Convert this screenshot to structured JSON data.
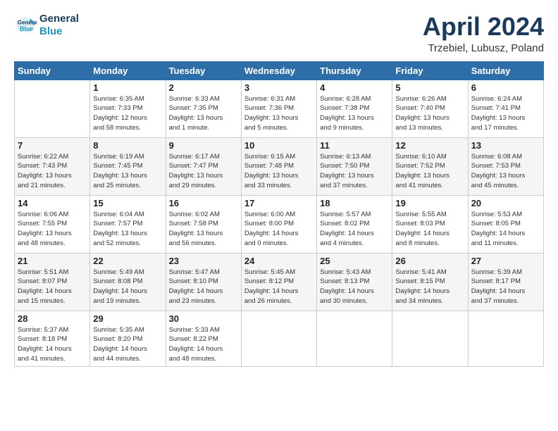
{
  "header": {
    "logo_line1": "General",
    "logo_line2": "Blue",
    "month": "April 2024",
    "location": "Trzebiel, Lubusz, Poland"
  },
  "weekdays": [
    "Sunday",
    "Monday",
    "Tuesday",
    "Wednesday",
    "Thursday",
    "Friday",
    "Saturday"
  ],
  "rows": [
    [
      {
        "day": "",
        "info": ""
      },
      {
        "day": "1",
        "info": "Sunrise: 6:35 AM\nSunset: 7:33 PM\nDaylight: 12 hours\nand 58 minutes."
      },
      {
        "day": "2",
        "info": "Sunrise: 6:33 AM\nSunset: 7:35 PM\nDaylight: 13 hours\nand 1 minute."
      },
      {
        "day": "3",
        "info": "Sunrise: 6:31 AM\nSunset: 7:36 PM\nDaylight: 13 hours\nand 5 minutes."
      },
      {
        "day": "4",
        "info": "Sunrise: 6:28 AM\nSunset: 7:38 PM\nDaylight: 13 hours\nand 9 minutes."
      },
      {
        "day": "5",
        "info": "Sunrise: 6:26 AM\nSunset: 7:40 PM\nDaylight: 13 hours\nand 13 minutes."
      },
      {
        "day": "6",
        "info": "Sunrise: 6:24 AM\nSunset: 7:41 PM\nDaylight: 13 hours\nand 17 minutes."
      }
    ],
    [
      {
        "day": "7",
        "info": "Sunrise: 6:22 AM\nSunset: 7:43 PM\nDaylight: 13 hours\nand 21 minutes."
      },
      {
        "day": "8",
        "info": "Sunrise: 6:19 AM\nSunset: 7:45 PM\nDaylight: 13 hours\nand 25 minutes."
      },
      {
        "day": "9",
        "info": "Sunrise: 6:17 AM\nSunset: 7:47 PM\nDaylight: 13 hours\nand 29 minutes."
      },
      {
        "day": "10",
        "info": "Sunrise: 6:15 AM\nSunset: 7:48 PM\nDaylight: 13 hours\nand 33 minutes."
      },
      {
        "day": "11",
        "info": "Sunrise: 6:13 AM\nSunset: 7:50 PM\nDaylight: 13 hours\nand 37 minutes."
      },
      {
        "day": "12",
        "info": "Sunrise: 6:10 AM\nSunset: 7:52 PM\nDaylight: 13 hours\nand 41 minutes."
      },
      {
        "day": "13",
        "info": "Sunrise: 6:08 AM\nSunset: 7:53 PM\nDaylight: 13 hours\nand 45 minutes."
      }
    ],
    [
      {
        "day": "14",
        "info": "Sunrise: 6:06 AM\nSunset: 7:55 PM\nDaylight: 13 hours\nand 48 minutes."
      },
      {
        "day": "15",
        "info": "Sunrise: 6:04 AM\nSunset: 7:57 PM\nDaylight: 13 hours\nand 52 minutes."
      },
      {
        "day": "16",
        "info": "Sunrise: 6:02 AM\nSunset: 7:58 PM\nDaylight: 13 hours\nand 56 minutes."
      },
      {
        "day": "17",
        "info": "Sunrise: 6:00 AM\nSunset: 8:00 PM\nDaylight: 14 hours\nand 0 minutes."
      },
      {
        "day": "18",
        "info": "Sunrise: 5:57 AM\nSunset: 8:02 PM\nDaylight: 14 hours\nand 4 minutes."
      },
      {
        "day": "19",
        "info": "Sunrise: 5:55 AM\nSunset: 8:03 PM\nDaylight: 14 hours\nand 8 minutes."
      },
      {
        "day": "20",
        "info": "Sunrise: 5:53 AM\nSunset: 8:05 PM\nDaylight: 14 hours\nand 11 minutes."
      }
    ],
    [
      {
        "day": "21",
        "info": "Sunrise: 5:51 AM\nSunset: 8:07 PM\nDaylight: 14 hours\nand 15 minutes."
      },
      {
        "day": "22",
        "info": "Sunrise: 5:49 AM\nSunset: 8:08 PM\nDaylight: 14 hours\nand 19 minutes."
      },
      {
        "day": "23",
        "info": "Sunrise: 5:47 AM\nSunset: 8:10 PM\nDaylight: 14 hours\nand 23 minutes."
      },
      {
        "day": "24",
        "info": "Sunrise: 5:45 AM\nSunset: 8:12 PM\nDaylight: 14 hours\nand 26 minutes."
      },
      {
        "day": "25",
        "info": "Sunrise: 5:43 AM\nSunset: 8:13 PM\nDaylight: 14 hours\nand 30 minutes."
      },
      {
        "day": "26",
        "info": "Sunrise: 5:41 AM\nSunset: 8:15 PM\nDaylight: 14 hours\nand 34 minutes."
      },
      {
        "day": "27",
        "info": "Sunrise: 5:39 AM\nSunset: 8:17 PM\nDaylight: 14 hours\nand 37 minutes."
      }
    ],
    [
      {
        "day": "28",
        "info": "Sunrise: 5:37 AM\nSunset: 8:18 PM\nDaylight: 14 hours\nand 41 minutes."
      },
      {
        "day": "29",
        "info": "Sunrise: 5:35 AM\nSunset: 8:20 PM\nDaylight: 14 hours\nand 44 minutes."
      },
      {
        "day": "30",
        "info": "Sunrise: 5:33 AM\nSunset: 8:22 PM\nDaylight: 14 hours\nand 48 minutes."
      },
      {
        "day": "",
        "info": ""
      },
      {
        "day": "",
        "info": ""
      },
      {
        "day": "",
        "info": ""
      },
      {
        "day": "",
        "info": ""
      }
    ]
  ]
}
